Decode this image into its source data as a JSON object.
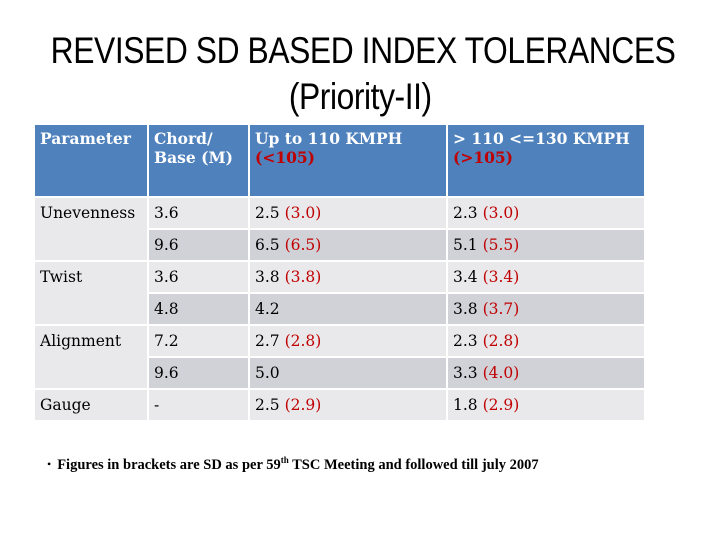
{
  "title": {
    "line1": "REVISED SD BASED INDEX TOLERANCES",
    "line2": "(Priority-II)"
  },
  "table": {
    "headers": [
      {
        "main": "Parameter",
        "sub": ""
      },
      {
        "main": "Chord/ Base (M)",
        "sub": ""
      },
      {
        "main": "Up to 110 KMPH",
        "sub": "(<105)"
      },
      {
        "main": "> 110 <=130 KMPH",
        "sub": "(>105)"
      }
    ],
    "rows": [
      {
        "parameter": "Unevenness",
        "chord": "3.6",
        "up110": "2.5",
        "up110_sd": "(3.0)",
        "gt110": "2.3",
        "gt110_sd": "(3.0)"
      },
      {
        "parameter": "",
        "chord": "9.6",
        "up110": "6.5",
        "up110_sd": "(6.5)",
        "gt110": "5.1",
        "gt110_sd": "(5.5)"
      },
      {
        "parameter": "Twist",
        "chord": "3.6",
        "up110": "3.8",
        "up110_sd": "(3.8)",
        "gt110": "3.4",
        "gt110_sd": "(3.4)"
      },
      {
        "parameter": "",
        "chord": "4.8",
        "up110": "4.2",
        "up110_sd": "",
        "gt110": "3.8",
        "gt110_sd": "(3.7)"
      },
      {
        "parameter": "Alignment",
        "chord": "7.2",
        "up110": "2.7",
        "up110_sd": "(2.8)",
        "gt110": "2.3",
        "gt110_sd": "(2.8)"
      },
      {
        "parameter": "",
        "chord": "9.6",
        "up110": "5.0",
        "up110_sd": "",
        "gt110": "3.3",
        "gt110_sd": "(4.0)"
      },
      {
        "parameter": "Gauge",
        "chord": "-",
        "up110": "2.5",
        "up110_sd": "(2.9)",
        "gt110": "1.8",
        "gt110_sd": "(2.9)"
      }
    ]
  },
  "note": {
    "bullet": "•",
    "text_before": "Figures in brackets are SD as per 59",
    "superscript": "th",
    "text_after": " TSC Meeting and followed till july 2007"
  },
  "colors": {
    "header_bg": "#4f81bd",
    "row_light": "#e9e9ec",
    "row_dark": "#d0d2d8",
    "sd_value": "#c00000"
  }
}
